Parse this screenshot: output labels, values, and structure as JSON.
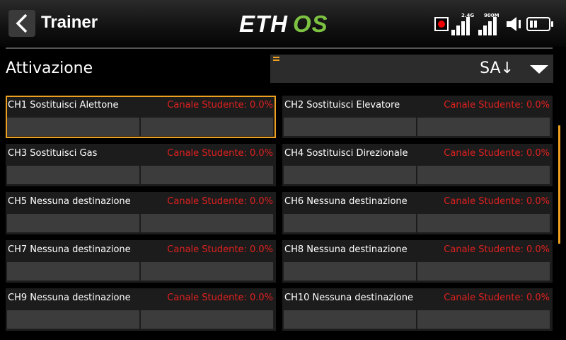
{
  "header": {
    "title": "Trainer",
    "logo": "ETHOS",
    "signal_24g_label": "2.4G",
    "signal_900m_label": "900M"
  },
  "activation": {
    "label": "Attivazione",
    "value": "SA↓"
  },
  "channels": [
    {
      "name": "CH1 Sostituisci Alettone",
      "value": "Canale Studente: 0.0%"
    },
    {
      "name": "CH2 Sostituisci Elevatore",
      "value": "Canale Studente: 0.0%"
    },
    {
      "name": "CH3 Sostituisci Gas",
      "value": "Canale Studente: 0.0%"
    },
    {
      "name": "CH4 Sostituisci Direzionale",
      "value": "Canale Studente: 0.0%"
    },
    {
      "name": "CH5 Nessuna destinazione",
      "value": "Canale Studente: 0.0%"
    },
    {
      "name": "CH6 Nessuna destinazione",
      "value": "Canale Studente: 0.0%"
    },
    {
      "name": "CH7 Nessuna destinazione",
      "value": "Canale Studente: 0.0%"
    },
    {
      "name": "CH8 Nessuna destinazione",
      "value": "Canale Studente: 0.0%"
    },
    {
      "name": "CH9 Nessuna destinazione",
      "value": "Canale Studente: 0.0%"
    },
    {
      "name": "CH10 Nessuna destinazione",
      "value": "Canale Studente: 0.0%"
    }
  ],
  "colors": {
    "accent": "#f0a020",
    "student_value": "#e02020",
    "logo_green": "#7dc242"
  }
}
